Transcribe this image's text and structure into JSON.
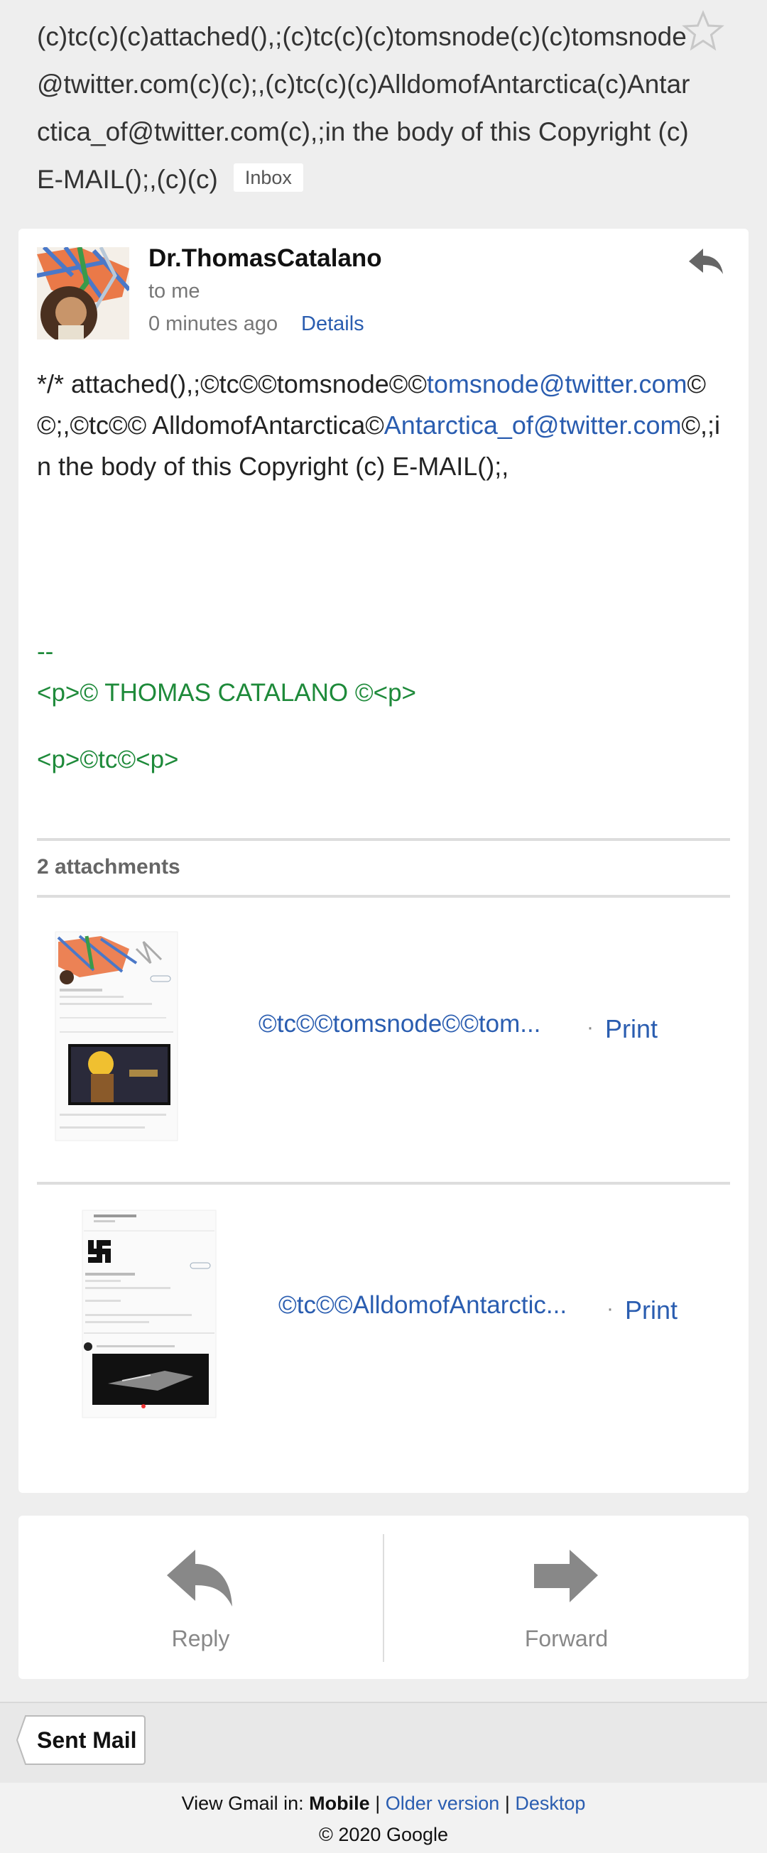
{
  "subject": {
    "text": "(c)tc(c)(c)attached(),;(c)tc(c)(c)tomsnode(c)(c)tomsnode@twitter.com(c)(c);,(c)tc(c)(c)AlldomofAntarctica(c)Antarctica_of@twitter.com(c),;in the body of this Copyright (c) E-MAIL();,(c)(c)",
    "label": "Inbox",
    "star_icon": "star-icon"
  },
  "message": {
    "sender": "Dr.ThomasCatalano",
    "to": "to me",
    "time": "0 minutes ago",
    "details_label": "Details",
    "reply_icon": "reply-icon",
    "body": {
      "part1": "*/* attached(),;©tc©©tomsnode©©",
      "link1": "tomsnode@twitter.com",
      "part2": "©©;,©tc©© AlldomofAntarctica©",
      "link2": "Antarctica_of@twitter.com",
      "part3": "©,;in the body of this Copyright (c) E-MAIL();,"
    },
    "signature": {
      "dashes": "--",
      "line1": "<p>© THOMAS CATALANO ©<p>",
      "line2": "<p>©tc©<p>"
    }
  },
  "attachments": {
    "title": "2 attachments",
    "items": [
      {
        "name": "©tc©©tomsnode©©tom...",
        "dot": "·",
        "print": "Print"
      },
      {
        "name": "©tc©©AlldomofAntarctic...",
        "dot": "·",
        "print": "Print"
      }
    ]
  },
  "actions": {
    "reply": "Reply",
    "forward": "Forward"
  },
  "folder": {
    "label": "Sent Mail"
  },
  "footer": {
    "view_in": "View Gmail in:",
    "mobile": "Mobile",
    "sep": "|",
    "older": "Older version",
    "desktop": "Desktop",
    "copyright": "© 2020 Google"
  },
  "colors": {
    "link": "#2a5db0",
    "signature": "#1e8a3a",
    "background": "#eeeeee"
  }
}
